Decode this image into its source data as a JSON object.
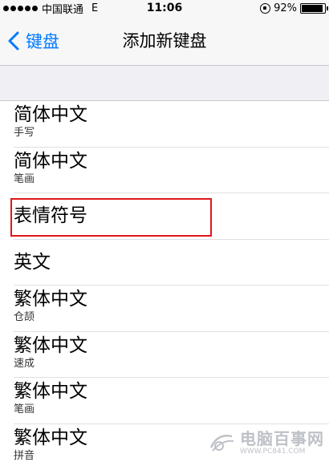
{
  "status_bar": {
    "carrier": "中国联通",
    "network": "E",
    "time": "11:06",
    "battery": "92%",
    "battery_level": 0.92
  },
  "nav": {
    "back_label": "键盘",
    "title": "添加新键盘",
    "accent_color": "#007aff"
  },
  "keyboards": [
    {
      "title": "简体中文",
      "subtitle": "手写"
    },
    {
      "title": "简体中文",
      "subtitle": "笔画"
    },
    {
      "title": "表情符号",
      "subtitle": ""
    },
    {
      "title": "英文",
      "subtitle": ""
    },
    {
      "title": "繁体中文",
      "subtitle": "仓颉"
    },
    {
      "title": "繁体中文",
      "subtitle": "速成"
    },
    {
      "title": "繁体中文",
      "subtitle": "笔画"
    },
    {
      "title": "繁体中文",
      "subtitle": "拼音"
    }
  ],
  "highlight_color": "#e0161b",
  "watermark": {
    "name": "电脑百事网",
    "url": "WWW.PC841.COM"
  }
}
